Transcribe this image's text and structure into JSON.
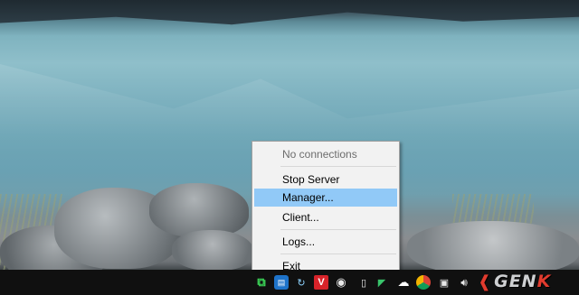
{
  "context_menu": {
    "items": [
      {
        "label": "No connections",
        "enabled": false
      },
      {
        "label": "Stop Server",
        "enabled": true
      },
      {
        "label": "Manager...",
        "enabled": true,
        "highlighted": true
      },
      {
        "label": "Client...",
        "enabled": true
      },
      {
        "label": "Logs...",
        "enabled": true
      },
      {
        "label": "Exit",
        "enabled": true
      }
    ]
  },
  "tray": {
    "icons": [
      "signal-icon",
      "chat-icon",
      "sync-icon",
      "v-app-icon",
      "eye-icon",
      "document-icon",
      "green-app-icon",
      "cloud-icon",
      "chrome-icon",
      "network-icon",
      "volume-icon"
    ]
  },
  "watermark": {
    "logo_text": "GENK",
    "accent_color": "#e23b2e"
  },
  "colors": {
    "menu_highlight": "#91c9f7",
    "taskbar": "#101010"
  }
}
